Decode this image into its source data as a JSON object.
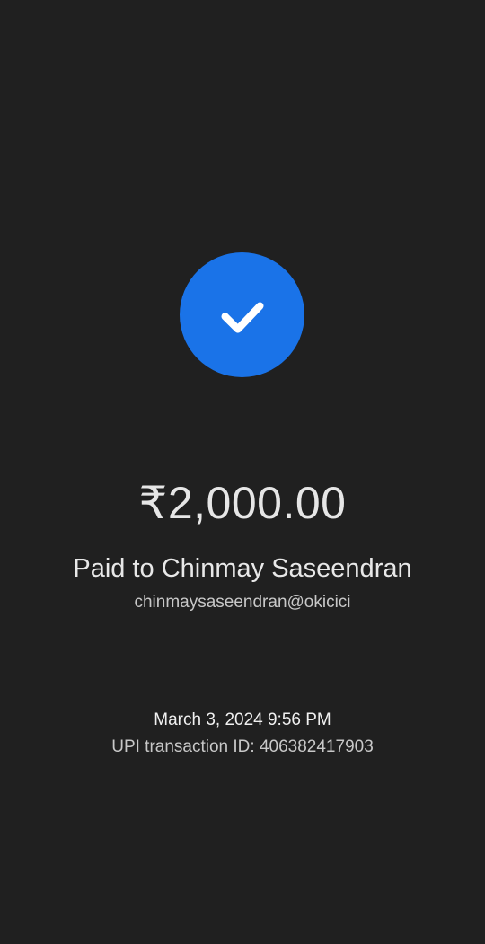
{
  "status": {
    "icon": "check-icon",
    "accent_color": "#1a73e8"
  },
  "payment": {
    "amount": "₹2,000.00",
    "paid_to": "Paid to Chinmay Saseendran",
    "upi_id": "chinmaysaseendran@okicici"
  },
  "transaction": {
    "datetime": "March 3, 2024 9:56 PM",
    "txn_id": "UPI transaction ID: 406382417903"
  }
}
